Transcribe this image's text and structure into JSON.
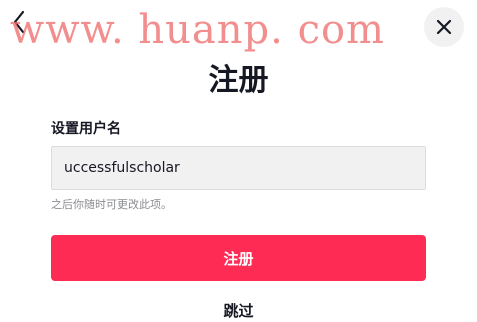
{
  "watermark": {
    "text": "www. huanp. com",
    "color": "#ee6e6e"
  },
  "header": {
    "back_icon": "chevron-left-icon",
    "close_icon": "close-icon",
    "title": "注册"
  },
  "form": {
    "username_label": "设置用户名",
    "username_value": "uccessfulscholar",
    "hint": "之后你随时可更改此项。",
    "submit_label": "注册",
    "skip_label": "跳过"
  },
  "colors": {
    "accent": "#fe2c55",
    "text": "#161823",
    "hint": "#8a8b91",
    "input_bg": "#f1f1f2"
  }
}
